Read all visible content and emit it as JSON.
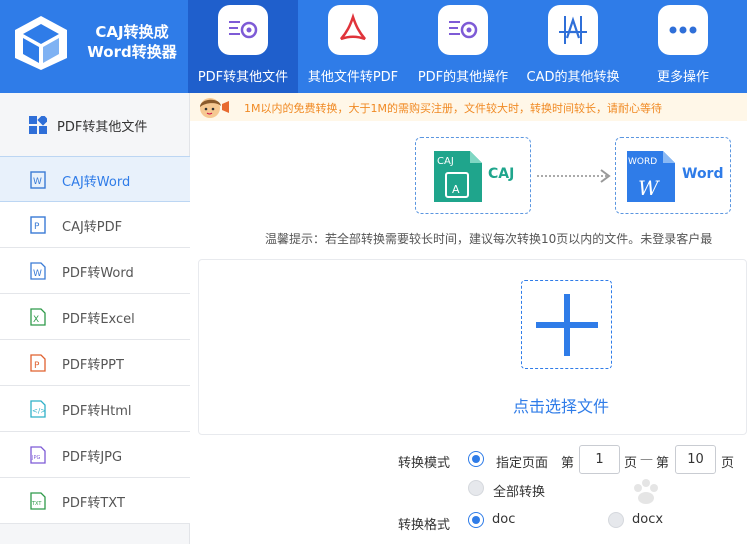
{
  "app": {
    "title_line1": "CAJ转换成",
    "title_line2": "Word转换器"
  },
  "nav": [
    {
      "label": "PDF转其他文件",
      "icon": "pdf-gear-icon",
      "active": true
    },
    {
      "label": "其他文件转PDF",
      "icon": "acrobat-icon",
      "active": false
    },
    {
      "label": "PDF的其他操作",
      "icon": "pdf-settings-icon",
      "active": false
    },
    {
      "label": "CAD的其他转换",
      "icon": "cad-icon",
      "active": false
    },
    {
      "label": "更多操作",
      "icon": "more-dots-icon",
      "active": false
    }
  ],
  "sidebar": {
    "header": "PDF转其他文件",
    "items": [
      {
        "label": "CAJ转Word",
        "icon": "word-doc-icon",
        "active": true
      },
      {
        "label": "CAJ转PDF",
        "icon": "pdf-doc-icon",
        "active": false
      },
      {
        "label": "PDF转Word",
        "icon": "word-file-icon",
        "active": false
      },
      {
        "label": "PDF转Excel",
        "icon": "excel-file-icon",
        "active": false
      },
      {
        "label": "PDF转PPT",
        "icon": "ppt-file-icon",
        "active": false
      },
      {
        "label": "PDF转Html",
        "icon": "html-file-icon",
        "active": false
      },
      {
        "label": "PDF转JPG",
        "icon": "jpg-file-icon",
        "active": false
      },
      {
        "label": "PDF转TXT",
        "icon": "txt-file-icon",
        "active": false
      }
    ]
  },
  "notice": "1M以内的免费转换，大于1M的需购买注册，文件较大时，转换时间较长，请耐心等待",
  "conversion": {
    "from_badge": "CAJ",
    "from_label": "CAJ",
    "to_badge": "WORD",
    "to_label": "Word"
  },
  "tip": "温馨提示：若全部转换需要较长时间，建议每次转换10页以内的文件。未登录客户最",
  "upload": {
    "label": "点击选择文件"
  },
  "options": {
    "mode_label": "转换模式",
    "mode_page": "指定页面",
    "page_prefix": "第",
    "page_from": "1",
    "page_suffix1": "页",
    "dash": "—",
    "page_prefix2": "第",
    "page_to": "10",
    "page_suffix2": "页",
    "mode_all": "全部转换",
    "format_label": "转换格式",
    "format_doc": "doc",
    "format_docx": "docx"
  },
  "colors": {
    "primary": "#2f7ce8",
    "active_nav": "#1f5fcc",
    "notice_text": "#f08a24"
  }
}
